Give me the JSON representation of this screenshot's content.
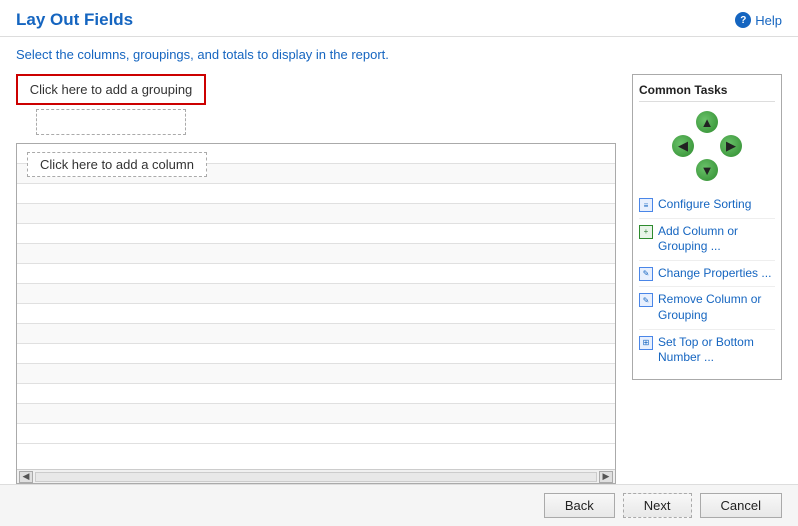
{
  "header": {
    "title": "Lay Out Fields",
    "help_label": "Help"
  },
  "subtitle": {
    "text_before": "Select the columns, groupings, and totals to ",
    "highlight": "display in the report",
    "text_after": "."
  },
  "left_panel": {
    "grouping_btn_label": "Click here to add a grouping",
    "column_btn_label": "Click here to add a column"
  },
  "right_panel": {
    "common_tasks_title": "Common Tasks",
    "arrows": {
      "up": "▲",
      "down": "▼",
      "left": "◀",
      "right": "▶"
    },
    "tasks": [
      {
        "id": "configure-sorting",
        "label": "Configure Sorting",
        "icon_type": "sort"
      },
      {
        "id": "add-column",
        "label": "Add Column or Grouping ...",
        "icon_type": "add"
      },
      {
        "id": "change-properties",
        "label": "Change Properties ...",
        "icon_type": "change"
      },
      {
        "id": "remove-column",
        "label": "Remove Column or Grouping",
        "icon_type": "remove"
      },
      {
        "id": "set-top-bottom",
        "label": "Set Top or Bottom Number ...",
        "icon_type": "top"
      }
    ]
  },
  "footer": {
    "back_label": "Back",
    "next_label": "Next",
    "cancel_label": "Cancel"
  }
}
